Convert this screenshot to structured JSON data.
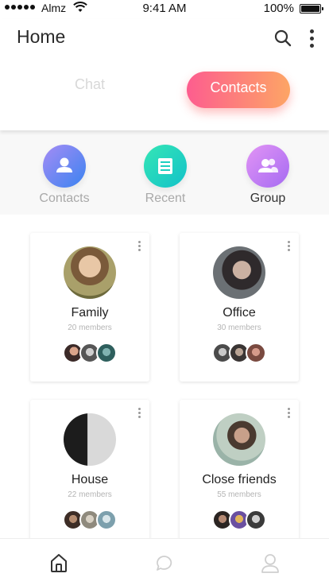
{
  "status_bar": {
    "carrier": "Almz",
    "time": "9:41 AM",
    "battery": "100%"
  },
  "header": {
    "title": "Home",
    "tabs": {
      "chat": "Chat",
      "contacts": "Contacts"
    }
  },
  "categories": [
    {
      "label": "Contacts",
      "icon": "person-icon"
    },
    {
      "label": "Recent",
      "icon": "document-icon"
    },
    {
      "label": "Group",
      "icon": "group-icon"
    }
  ],
  "groups": [
    {
      "name": "Family",
      "members": "20 members"
    },
    {
      "name": "Office",
      "members": "30 members"
    },
    {
      "name": "House",
      "members": "22 members"
    },
    {
      "name": "Close friends",
      "members": "55 members"
    }
  ],
  "bottom_nav": [
    {
      "icon": "home-icon",
      "active": true
    },
    {
      "icon": "chat-bubble-icon",
      "active": false
    },
    {
      "icon": "profile-icon",
      "active": false
    }
  ],
  "colors": {
    "accent_start": "#fd5d8f",
    "accent_end": "#fda565"
  }
}
